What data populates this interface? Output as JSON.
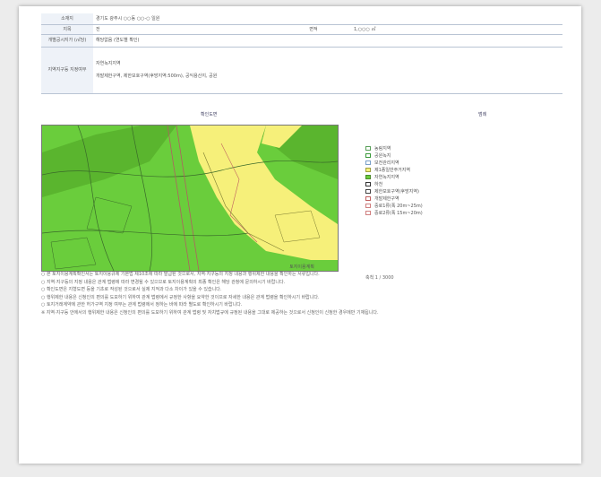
{
  "document": {
    "info_rows": [
      {
        "label": "소재지",
        "value": "경기도 광주시 ○○동 ○○-○ 일원"
      },
      {
        "label": "지목",
        "value": "전",
        "label2": "면적",
        "value2": "1,○○○ ㎡"
      },
      {
        "label": "개별공시지가 (㎡당)",
        "value": "해당없음 (연도별 확인)"
      },
      {
        "label": "지역지구등 지정여부",
        "value": "자연녹지지역",
        "value_line2": "개발제한구역, 제한보호구역(후방지역:500m), 공익용산지, 공원"
      }
    ],
    "map": {
      "title": "확인도면",
      "legend_title": "범례",
      "legend": [
        {
          "label": "농림지역",
          "color": "#ffffff",
          "border": "#5aa05a"
        },
        {
          "label": "공원녹지",
          "color": "#ffffff",
          "border": "#3a9a3a"
        },
        {
          "label": "보전관리지역",
          "color": "#ffffff",
          "border": "#7aa0c8"
        },
        {
          "label": "제1종일반주거지역",
          "color": "#f6f07a",
          "border": "#a0a040"
        },
        {
          "label": "자연녹지지역",
          "color": "#6acd3c",
          "border": "#4a8a2a"
        },
        {
          "label": "하천",
          "color": "#ffffff",
          "border": "#333333"
        },
        {
          "label": "제한보호구역(후방지역)",
          "color": "#ffffff",
          "border": "#444444"
        },
        {
          "label": "개발제한구역",
          "color": "#ffffff",
          "border": "#c06060"
        },
        {
          "label": "중로1류(폭 20m~25m)",
          "color": "#ffffff",
          "border": "#d08080"
        },
        {
          "label": "중로2류(폭 15m~20m)",
          "color": "#ffffff",
          "border": "#d08080"
        }
      ],
      "scale": "축척 1 / 3000"
    },
    "figure_caption": "토지이용계획",
    "paragraphs": [
      "○ 본 토지이용계획확인서는 토지이용규제 기본법 제10조에 따라 발급된 것으로서, 지역·지구등의 지정 내용과 행위제한 내용을 확인하는 서류입니다.",
      "○ 지역·지구등의 지정 내용은 관계 법령에 따라 변경될 수 있으므로 토지이용계획의 최종 확인은 해당 관청에 문의하시기 바랍니다.",
      "○ 확인도면은 지형도면 등을 기초로 작성된 것으로서 실제 지적과 다소 차이가 있을 수 있습니다.",
      "○ 행위제한 내용은 신청인의 편의를 도모하기 위하여 관계 법령에서 규정한 사항을 요약한 것이므로 자세한 내용은 관계 법령을 확인하시기 바랍니다.",
      "○ 토지거래계약에 관한 허가구역 지정 여부는 관계 법령에서 정하는 바에 따라 별도로 확인하시기 바랍니다.",
      "※ 지역·지구등 안에서의 행위제한 내용은 신청인의 편의를 도모하기 위하여 관계 법령 및 자치법규에 규정된 내용을 그대로 제공하는 것으로서 신청인이 신청한 경우에만 기재됩니다."
    ]
  },
  "colors": {
    "green": "#6acd3c",
    "dark_green": "#5ab52e",
    "yellow": "#f6f07a",
    "label_bg": "#eef2f8"
  }
}
